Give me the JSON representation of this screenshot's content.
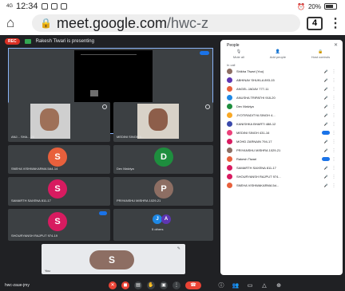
{
  "status_bar": {
    "signal": "4G",
    "time": "12:34",
    "battery": "20%"
  },
  "browser": {
    "host": "meet.google.com",
    "path": "/hwc-z",
    "tab_count": "4"
  },
  "meet": {
    "rec_label": "REC",
    "presenting_text": "Rakesh Tiwari is presenting",
    "screen_tile_name": "Rakesh Tiwari",
    "tiles": [
      {
        "name": "ANJ... SHA... 20",
        "type": "video"
      },
      {
        "name": "MEDINI SINGH 1...",
        "type": "video"
      },
      {
        "name": "SNEHA VISHWAKARMA 5a4-14",
        "initial": "S",
        "color": "#e8603c"
      },
      {
        "name": "Dev Malviya",
        "initial": "D",
        "color": "#1e8e3e"
      },
      {
        "name": "SAMARTH SAXENA 811-17",
        "initial": "S",
        "color": "#d81b60"
      },
      {
        "name": "PRIYANSHU MISHRA 1029-21",
        "initial": "P",
        "color": "#8d6e63"
      },
      {
        "name": "SHOURYANSH RAJPUT 974-19",
        "initial": "S",
        "color": "#d81b60"
      }
    ],
    "others": {
      "avatars": [
        {
          "initial": "J",
          "color": "#1e88e5"
        },
        {
          "initial": "A",
          "color": "#5e35b1"
        }
      ],
      "label": "5 others"
    },
    "self_tile": {
      "name": "You",
      "initial": "S",
      "color": "#8d6e63"
    },
    "meeting_code": "hwc-zaue-jmy"
  },
  "people_panel": {
    "title": "People",
    "actions": [
      {
        "label": "Mute all",
        "icon": "mic-off-icon"
      },
      {
        "label": "Add people",
        "icon": "person-add-icon"
      },
      {
        "label": "Host controls",
        "icon": "lock-icon"
      }
    ],
    "in_call_label": "In call",
    "participants": [
      {
        "name": "Shikha Tiwari (You)",
        "color": "#8d6e63"
      },
      {
        "name": "ABHINAV SHUKLA 893-15",
        "color": "#5e35b1"
      },
      {
        "name": "ANGEL JADAV 777-11",
        "color": "#e8603c"
      },
      {
        "name": "ANUSHA TRIPATHI 918-20",
        "color": "#1e88e5"
      },
      {
        "name": "Dev Malviya",
        "color": "#1e8e3e"
      },
      {
        "name": "JYOTIRADITYA SINGH 4...",
        "color": "#f9a825"
      },
      {
        "name": "KANISHKA BHARTI 488-12",
        "color": "#3949ab"
      },
      {
        "name": "MEDINI SINGH 431-16",
        "color": "#ec407a",
        "speaking": true
      },
      {
        "name": "MOHD ZARNAIN 794-17",
        "color": "#d81b60"
      },
      {
        "name": "PRIYANSHU MISHRA 1029-21",
        "color": "#8d6e63"
      },
      {
        "name": "Rakesh Tiwari",
        "color": "#e8603c",
        "speaking": true
      },
      {
        "name": "SAMARTH SAXENA 811-17",
        "color": "#d81b60"
      },
      {
        "name": "SHOURYANSH RAJPUT 974...",
        "color": "#d81b60"
      },
      {
        "name": "SNEHA VISHWAKARMA 5d...",
        "color": "#e8603c"
      }
    ]
  }
}
